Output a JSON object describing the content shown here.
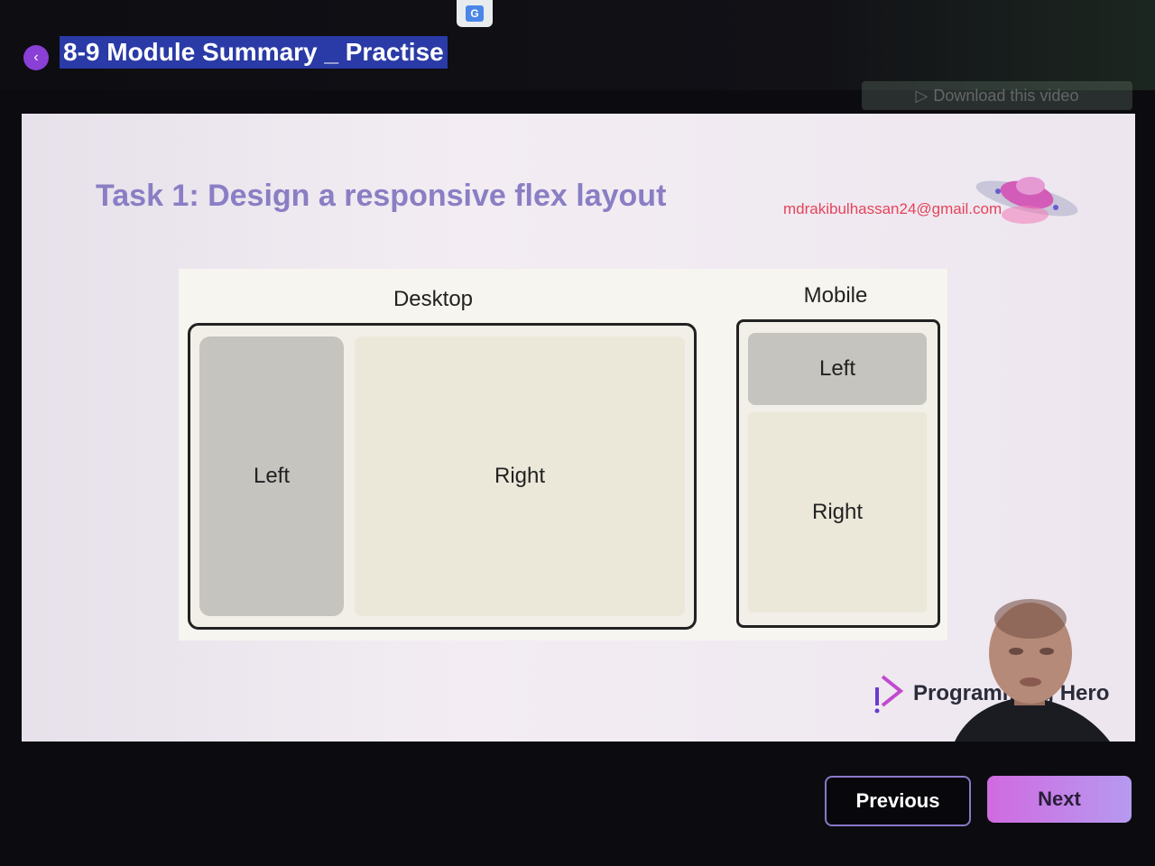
{
  "header": {
    "module_title": "8-9 Module Summary _ Practise",
    "translate_label": "G",
    "download_label": "Download this video"
  },
  "slide": {
    "task_title": "Task 1: Design a responsive flex layout",
    "email": "mdrakibulhassan24@gmail.com",
    "diagram": {
      "desktop": {
        "label": "Desktop",
        "left": "Left",
        "right": "Right"
      },
      "mobile": {
        "label": "Mobile",
        "left": "Left",
        "right": "Right"
      }
    },
    "brand": {
      "text": "Programming Hero"
    }
  },
  "nav": {
    "previous_label": "Previous",
    "next_label": "Next"
  },
  "colors": {
    "accent_purple": "#8a3fd6",
    "title_color": "#8a7ec4",
    "email_color": "#e4445a",
    "next_gradient_start": "#d06ae0"
  }
}
